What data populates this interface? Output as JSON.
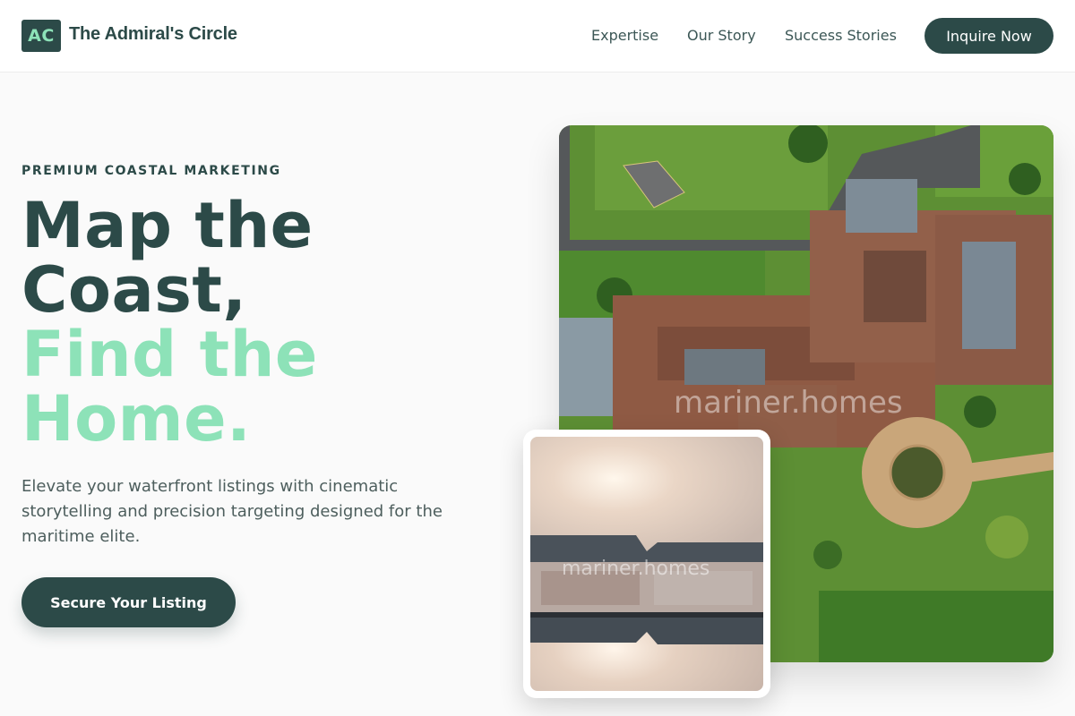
{
  "brand": {
    "logo_text": "AC",
    "name": "The Admiral's Circle"
  },
  "nav": {
    "links": [
      "Expertise",
      "Our Story",
      "Success Stories"
    ],
    "cta_label": "Inquire Now"
  },
  "hero": {
    "eyebrow": "PREMIUM COASTAL MARKETING",
    "headline_dark": [
      "Map the",
      "Coast,"
    ],
    "headline_accent": [
      "Find the",
      "Home."
    ],
    "description": "Elevate your waterfront listings with cinematic storytelling and precision targeting designed for the maritime elite.",
    "cta_label": "Secure Your Listing"
  },
  "images": {
    "aerial_watermark": "mariner.homes",
    "inset_watermark": "mariner.homes"
  },
  "colors": {
    "primary": "#2c4a48",
    "accent": "#8de2b8",
    "background": "#fafafa",
    "body_text": "#4d5e5d"
  }
}
